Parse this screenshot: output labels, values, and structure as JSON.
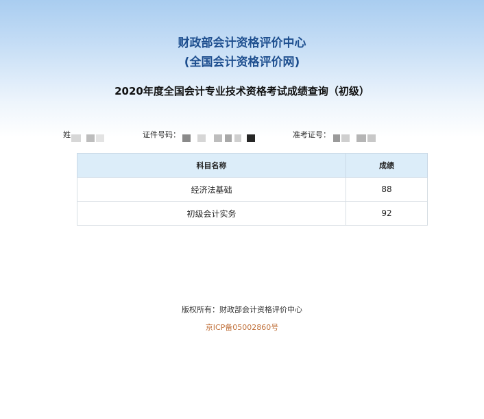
{
  "header": {
    "org_title": "财政部会计资格评价中心",
    "org_subtitle": "(全国会计资格评价网)",
    "query_title": "2020年度全国会计专业技术资格考试成绩查询（初级）"
  },
  "candidate": {
    "name_label": "姓",
    "id_label": "证件号码：",
    "ticket_label": "准考证号："
  },
  "scores_table": {
    "headers": [
      "科目名称",
      "成绩"
    ],
    "rows": [
      {
        "subject": "经济法基础",
        "score": "88"
      },
      {
        "subject": "初级会计实务",
        "score": "92"
      }
    ]
  },
  "footer": {
    "copyright": "版权所有：财政部会计资格评价中心",
    "icp": "京ICP备05002860号"
  },
  "colors": {
    "title_blue": "#1e4f8f",
    "table_header_bg": "#dcedf9",
    "icp_link": "#c0703a"
  }
}
